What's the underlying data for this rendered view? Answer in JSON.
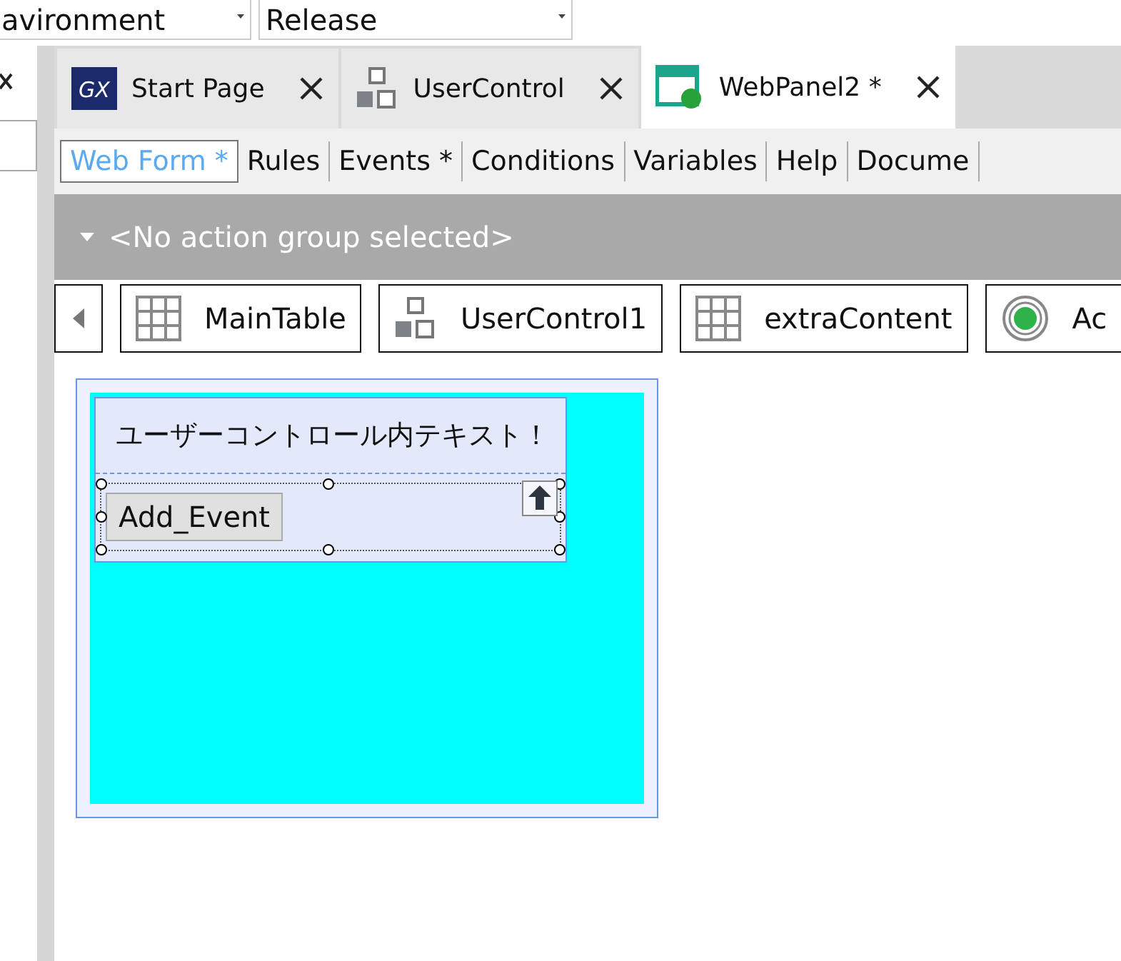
{
  "toolbar": {
    "environment": "avironment",
    "configuration": "Release"
  },
  "tabs": [
    {
      "label": "Start Page",
      "kind": "gx",
      "logo_text": "GX",
      "selected": false
    },
    {
      "label": "UserControl",
      "kind": "blocks",
      "selected": false
    },
    {
      "label": "WebPanel2 *",
      "kind": "webpanel",
      "selected": true
    }
  ],
  "subtabs": [
    {
      "label": "Web Form *",
      "selected": true
    },
    {
      "label": "Rules",
      "selected": false
    },
    {
      "label": "Events *",
      "selected": false
    },
    {
      "label": "Conditions",
      "selected": false
    },
    {
      "label": "Variables",
      "selected": false
    },
    {
      "label": "Help",
      "selected": false
    },
    {
      "label": "Docume",
      "selected": false
    }
  ],
  "action_group": "<No action group selected>",
  "breadcrumbs": [
    {
      "label": "MainTable",
      "kind": "grid"
    },
    {
      "label": "UserControl1",
      "kind": "blocks"
    },
    {
      "label": "extraContent",
      "kind": "grid"
    },
    {
      "label": "Ac",
      "kind": "radio"
    }
  ],
  "form": {
    "text": "ユーザーコントロール内テキスト！",
    "button": "Add_Event"
  }
}
